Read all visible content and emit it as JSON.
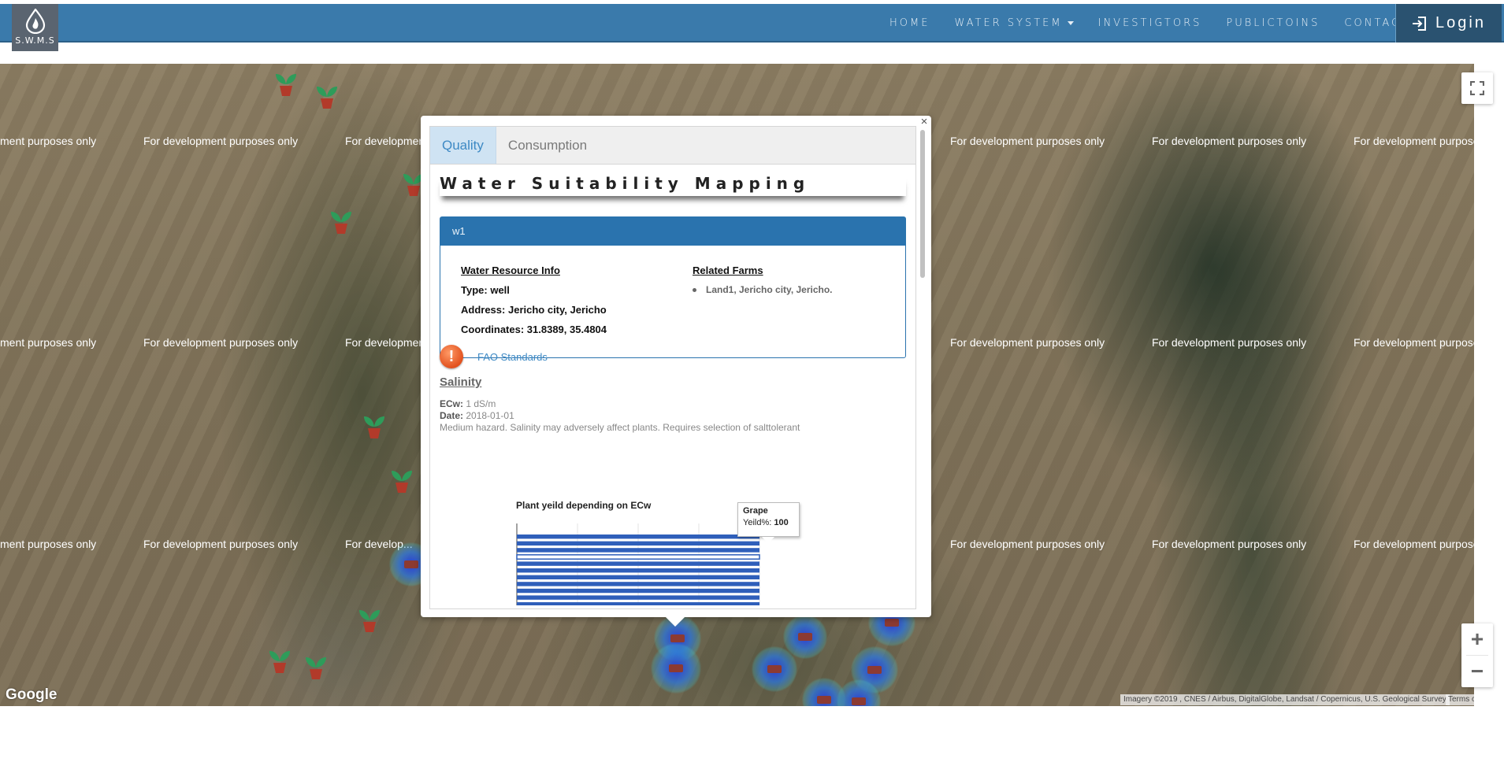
{
  "logo": {
    "text": "S.W.M.S"
  },
  "nav": {
    "items": [
      {
        "label": "HOME",
        "has_caret": false
      },
      {
        "label": "WATER SYSTEM",
        "has_caret": true
      },
      {
        "label": "INVESTIGTORS",
        "has_caret": false
      },
      {
        "label": "PUBLICTOINS",
        "has_caret": false
      },
      {
        "label": "CONTACT",
        "has_caret": false
      }
    ],
    "login_label": "Login"
  },
  "map": {
    "watermark": "For development purposes only",
    "watermark_partial_left": "ment purposes only",
    "watermark_partial_mid": "For developmen",
    "watermark_partial_mid2": "For develop...",
    "watermark_partial_right": "For development purposes on",
    "google_label": "Google",
    "attribution": "Imagery ©2019 , CNES / Airbus, DigitalGlobe, Landsat / Copernicus, U.S. Geological Survey",
    "terms_label": "Terms of Use",
    "zoom_in_label": "+",
    "zoom_out_label": "−"
  },
  "popup": {
    "close_label": "×",
    "tabs": [
      {
        "label": "Quality",
        "active": true
      },
      {
        "label": "Consumption",
        "active": false
      }
    ],
    "title": "Water Suitability Mapping",
    "panel": {
      "header": "w1",
      "resource_heading": "Water Resource Info",
      "type_label": "Type:",
      "type_value": "well",
      "address_label": "Address:",
      "address_value": "Jericho city, Jericho",
      "coords_label": "Coordinates:",
      "coords_value": "31.8389, 35.4804",
      "farms_heading": "Related Farms",
      "farms": [
        "Land1, Jericho city, Jericho."
      ]
    },
    "fao_link": "FAO Standards",
    "salinity": {
      "heading": "Salinity",
      "ecw_label": "ECw:",
      "ecw_value": "1 dS/m",
      "date_label": "Date:",
      "date_value": "2018-01-01",
      "note": "Medium hazard. Salinity may adversely affect plants. Requires selection of salttolerant"
    }
  },
  "chart_data": {
    "type": "bar",
    "orientation": "horizontal",
    "title": "Plant yeild depending on ECw",
    "xlim": [
      0,
      100
    ],
    "values": [
      100,
      100,
      100,
      100,
      100,
      100,
      100,
      100,
      100,
      100,
      100
    ],
    "highlighted_index": 3,
    "bar_color": "#2f5fba",
    "grid": true,
    "tooltip": {
      "name": "Grape",
      "label": "Yeild%:",
      "value": "100"
    }
  },
  "colors": {
    "navbar": "#3a7aab",
    "login_bg": "#2a5270",
    "accent_link": "#3d89c4",
    "panel_header": "#2a73ae"
  }
}
